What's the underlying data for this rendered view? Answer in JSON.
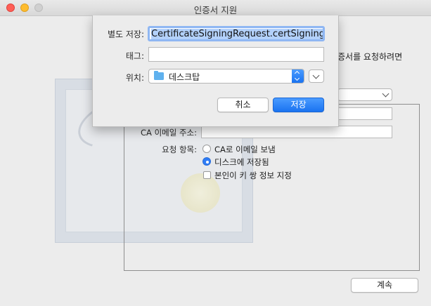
{
  "window": {
    "title": "인증서 지원"
  },
  "form": {
    "header_partial": "증서를 요청하려면",
    "ca_email_label": "CA 이메일 주소:",
    "request_label": "요청 항목:",
    "options": [
      {
        "label": "CA로 이메일 보냄",
        "selected": false
      },
      {
        "label": "디스크에 저장됨",
        "selected": true
      }
    ],
    "checkbox_label": "본인이 키 쌍 정보 지정",
    "checkbox_checked": false,
    "continue_label": "계속"
  },
  "sheet": {
    "save_as_label": "별도 저장:",
    "save_as_value": "CertificateSigningRequest.certSigningRequest",
    "tags_label": "태그:",
    "where_label": "위치:",
    "where_value": "데스크탑",
    "cancel_label": "취소",
    "save_label": "저장"
  },
  "colors": {
    "accent": "#1a73f0",
    "selection": "#b3d1fb",
    "folder": "#5fb1ee"
  }
}
